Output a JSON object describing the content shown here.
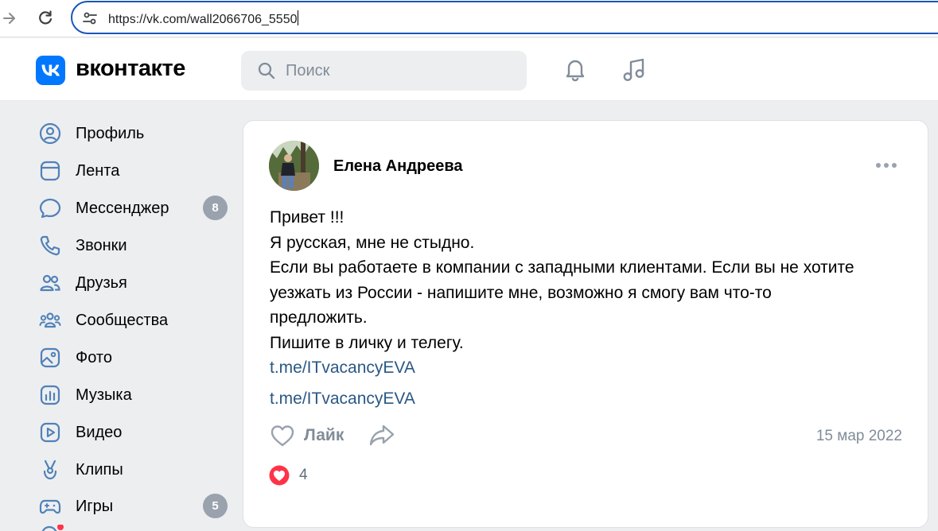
{
  "browser": {
    "url": "https://vk.com/wall2066706_5550"
  },
  "header": {
    "brand": "вконтакте",
    "search_placeholder": "Поиск",
    "accent_color": "#0077ff"
  },
  "sidebar": {
    "items": [
      {
        "label": "Профиль",
        "icon": "profile-icon"
      },
      {
        "label": "Лента",
        "icon": "feed-icon"
      },
      {
        "label": "Мессенджер",
        "icon": "messenger-icon",
        "badge": "8"
      },
      {
        "label": "Звонки",
        "icon": "phone-icon"
      },
      {
        "label": "Друзья",
        "icon": "friends-icon"
      },
      {
        "label": "Сообщества",
        "icon": "communities-icon"
      },
      {
        "label": "Фото",
        "icon": "photo-icon"
      },
      {
        "label": "Музыка",
        "icon": "music-icon"
      },
      {
        "label": "Видео",
        "icon": "video-icon"
      },
      {
        "label": "Клипы",
        "icon": "clips-icon"
      },
      {
        "label": "Игры",
        "icon": "games-icon",
        "badge": "5"
      }
    ]
  },
  "post": {
    "author": "Елена Андреева",
    "text_lines": [
      "Привет !!!",
      "Я русская, мне не стыдно.",
      "Если вы работаете в компании с западными клиентами. Если вы не хотите",
      "уезжать из России - напишите мне, возможно я смогу вам что-то",
      "предложить.",
      "Пишите в личку и телегу."
    ],
    "link_inline": "t.me/ITvacancyEVA",
    "link_attachment": "t.me/ITvacancyEVA",
    "like_label": "Лайк",
    "date": "15 мар 2022",
    "reactions_count": "4"
  }
}
